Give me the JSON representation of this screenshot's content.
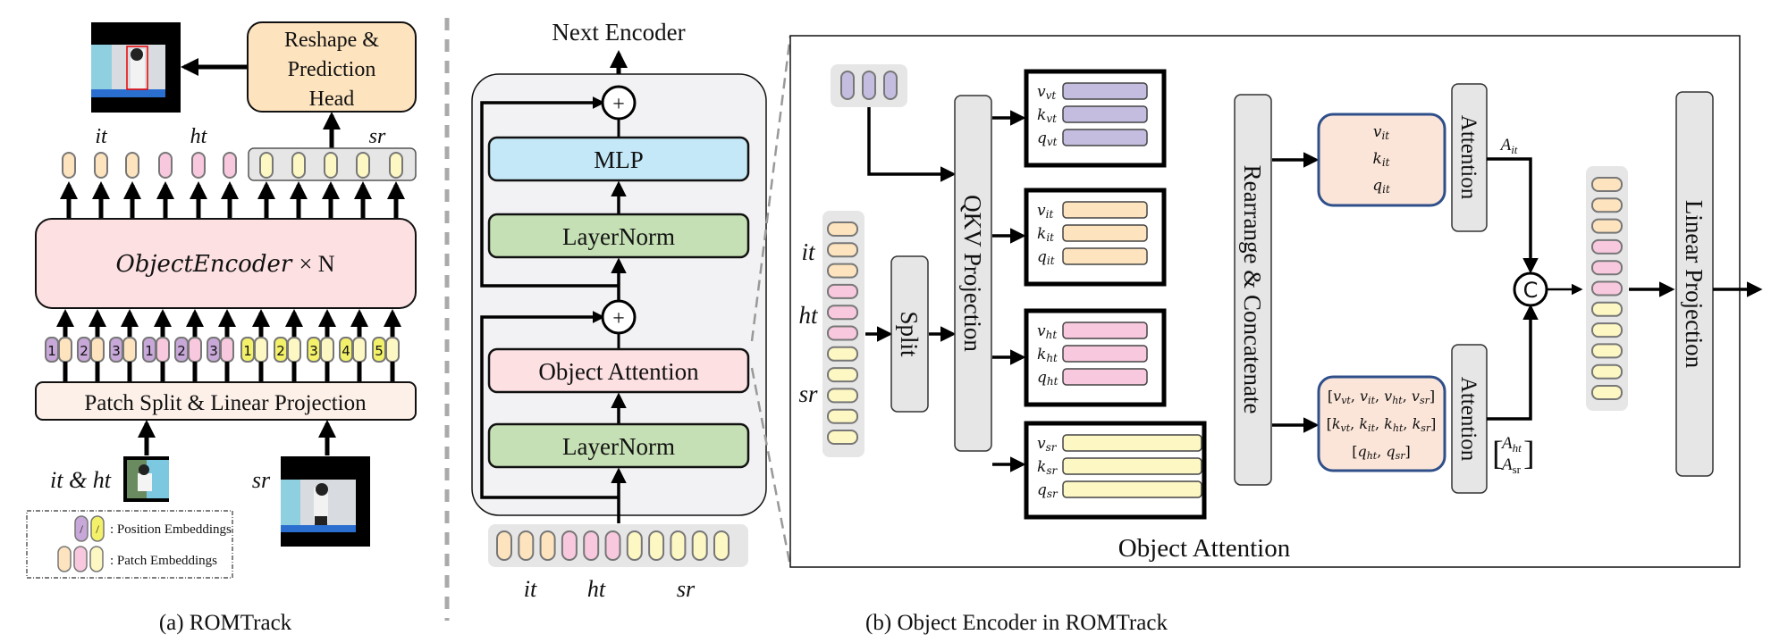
{
  "colors": {
    "it": "#fde3be",
    "ht": "#f8c8de",
    "sr": "#fdf7c3",
    "vt": "#c4bde0",
    "pos_purple": "#c8a8d8",
    "pos_yellow": "#f3f16a",
    "encoder_pink": "#fde0e2",
    "patch_split": "#fdf0e8",
    "reshape_orange": "#fde3be",
    "mlp_blue": "#c4e8f8",
    "layernorm_green": "#c5e0b4",
    "gray_block": "#e6e6e6",
    "attn_box": "#fbe5d8",
    "attn_border": "#2f4f8a"
  },
  "panel_a": {
    "caption": "(a) ROMTrack",
    "reshape_head": [
      "Reshape &",
      "Prediction",
      "Head"
    ],
    "output_labels": {
      "it": "it",
      "ht": "ht",
      "sr": "sr"
    },
    "object_encoder": {
      "name": "ObjectEncoder",
      "suffix": "× N"
    },
    "patch_split": "Patch Split & Linear Projection",
    "position_numbers": [
      "1",
      "2",
      "3",
      "1",
      "2",
      "3",
      "1",
      "2",
      "3",
      "4",
      "5"
    ],
    "input_labels": {
      "template": "it & ht",
      "search": "sr"
    },
    "legend": {
      "position": ": Position Embeddings",
      "patch": ": Patch Embeddings",
      "slash": "/"
    }
  },
  "panel_b": {
    "caption": "(b) Object Encoder in ROMTrack",
    "next_encoder": "Next Encoder",
    "mlp": "MLP",
    "layernorm_top": "LayerNorm",
    "object_attention": "Object Attention",
    "layernorm_bottom": "LayerNorm",
    "plus": "+",
    "token_labels": {
      "it": "it",
      "ht": "ht",
      "sr": "sr"
    }
  },
  "object_attention": {
    "title": "Object Attention",
    "vt_label": "vt",
    "input_labels": {
      "it": "it",
      "ht": "ht",
      "sr": "sr"
    },
    "split": "Split",
    "qkv_projection": "QKV Projection",
    "groups": [
      {
        "key": "vt",
        "rows": [
          {
            "base": "v",
            "sub": "vt"
          },
          {
            "base": "k",
            "sub": "vt"
          },
          {
            "base": "q",
            "sub": "vt"
          }
        ]
      },
      {
        "key": "it",
        "rows": [
          {
            "base": "v",
            "sub": "it"
          },
          {
            "base": "k",
            "sub": "it"
          },
          {
            "base": "q",
            "sub": "it"
          }
        ]
      },
      {
        "key": "ht",
        "rows": [
          {
            "base": "v",
            "sub": "ht"
          },
          {
            "base": "k",
            "sub": "ht"
          },
          {
            "base": "q",
            "sub": "ht"
          }
        ]
      },
      {
        "key": "sr",
        "rows": [
          {
            "base": "v",
            "sub": "sr"
          },
          {
            "base": "k",
            "sub": "sr"
          },
          {
            "base": "q",
            "sub": "sr"
          }
        ]
      }
    ],
    "rearrange": "Rearrange & Concatenate",
    "upper_box": [
      "v_it",
      "k_it",
      "q_it"
    ],
    "lower_box": [
      "[v_vt, v_it, v_ht, v_sr]",
      "[k_vt, k_it, k_ht, k_sr]",
      "[q_ht, q_sr]"
    ],
    "attention": "Attention",
    "a_it": {
      "base": "A",
      "sub": "it"
    },
    "a_lower": [
      {
        "base": "A",
        "sub": "ht"
      },
      {
        "base": "A",
        "sub": "sr"
      }
    ],
    "concat_symbol": "C",
    "linear_projection": "Linear Projection"
  }
}
